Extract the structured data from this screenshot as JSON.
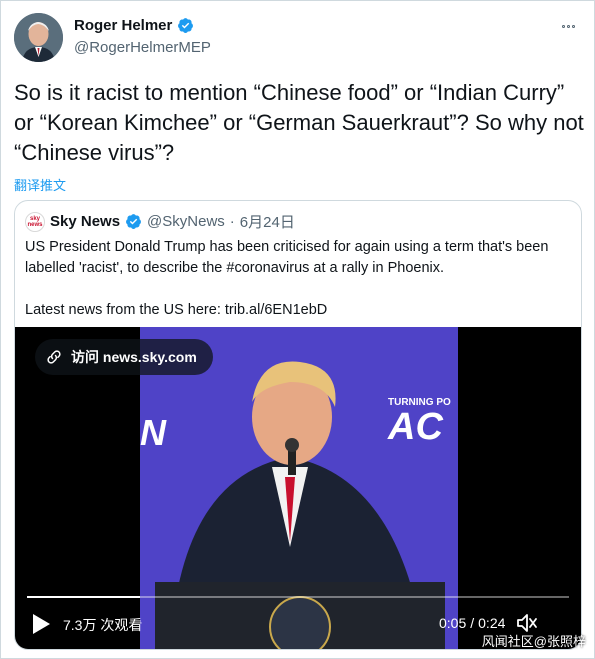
{
  "tweet": {
    "author_name": "Roger Helmer",
    "author_handle": "@RogerHelmerMEP",
    "text": "So is it racist to mention “Chinese food” or “Indian Curry” or “Korean Kimchee” or “German Sauerkraut”? So why not “Chinese virus”?",
    "translate_label": "翻译推文"
  },
  "quote": {
    "logo_text": "sky news",
    "name": "Sky News",
    "handle": "@SkyNews",
    "separator": "·",
    "date": "6月24日",
    "text": "US President Donald Trump has been criticised for again using a term that's been labelled 'racist', to describe the #coronavirus at a rally in Phoenix.\n\nLatest news from the US here: trib.al/6EN1ebD",
    "video": {
      "link_label": "访问 news.sky.com",
      "views": "7.3万 次观看",
      "time_current": "0:05",
      "time_sep": "/",
      "time_total": "0:24",
      "progress_fraction": 0.208,
      "stage_text_left": "N",
      "stage_text_right_small": "TURNING PO",
      "stage_text_right_big": "AC"
    }
  },
  "watermark": "风闻社区@张照梓",
  "colors": {
    "accent": "#1d9bf0",
    "stage": "#4f43c7"
  }
}
